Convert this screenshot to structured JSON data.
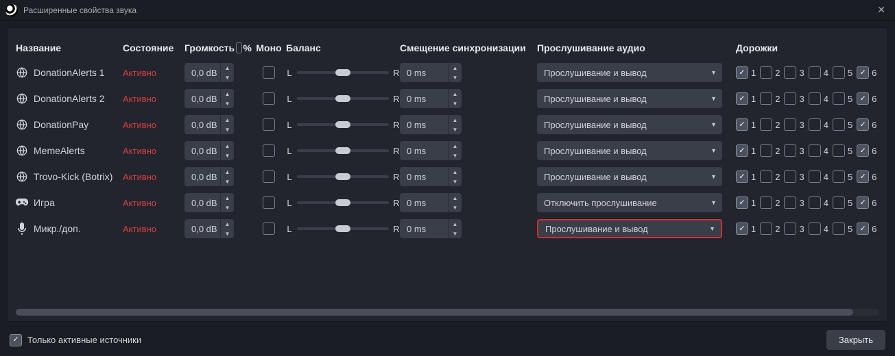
{
  "window": {
    "title": "Расширенные свойства звука"
  },
  "headers": {
    "name": "Название",
    "state": "Состояние",
    "volume": "Громкость",
    "pct": "%",
    "mono": "Моно",
    "balance": "Баланс",
    "sync": "Смещение синхронизации",
    "listen": "Прослушивание аудио",
    "tracks": "Дорожки"
  },
  "balance": {
    "left": "L",
    "right": "R"
  },
  "tracks": [
    "1",
    "2",
    "3",
    "4",
    "5",
    "6"
  ],
  "rows": [
    {
      "icon": "globe",
      "name": "DonationAlerts 1",
      "state": "Активно",
      "vol": "0,0 dB",
      "mono": false,
      "sync": "0 ms",
      "listen": "Прослушивание и вывод",
      "hl": false,
      "checks": [
        true,
        false,
        false,
        false,
        false,
        true
      ]
    },
    {
      "icon": "globe",
      "name": "DonationAlerts 2",
      "state": "Активно",
      "vol": "0,0 dB",
      "mono": false,
      "sync": "0 ms",
      "listen": "Прослушивание и вывод",
      "hl": false,
      "checks": [
        true,
        false,
        false,
        false,
        false,
        true
      ]
    },
    {
      "icon": "globe",
      "name": "DonationPay",
      "state": "Активно",
      "vol": "0,0 dB",
      "mono": false,
      "sync": "0 ms",
      "listen": "Прослушивание и вывод",
      "hl": false,
      "checks": [
        true,
        false,
        false,
        false,
        false,
        true
      ]
    },
    {
      "icon": "globe",
      "name": "MemeAlerts",
      "state": "Активно",
      "vol": "0,0 dB",
      "mono": false,
      "sync": "0 ms",
      "listen": "Прослушивание и вывод",
      "hl": false,
      "checks": [
        true,
        false,
        false,
        false,
        false,
        true
      ]
    },
    {
      "icon": "globe",
      "name": "Trovo-Kick (Botrix)",
      "state": "Активно",
      "vol": "0,0 dB",
      "mono": false,
      "sync": "0 ms",
      "listen": "Прослушивание и вывод",
      "hl": false,
      "checks": [
        true,
        false,
        false,
        false,
        false,
        true
      ]
    },
    {
      "icon": "gamepad",
      "name": "Игра",
      "state": "Активно",
      "vol": "0,0 dB",
      "mono": false,
      "sync": "0 ms",
      "listen": "Отключить прослушивание",
      "hl": false,
      "checks": [
        true,
        false,
        false,
        false,
        false,
        true
      ]
    },
    {
      "icon": "mic",
      "name": "Микр./доп.",
      "state": "Активно",
      "vol": "0,0 dB",
      "mono": false,
      "sync": "0 ms",
      "listen": "Прослушивание и вывод",
      "hl": true,
      "checks": [
        true,
        false,
        false,
        false,
        false,
        true
      ]
    }
  ],
  "footer": {
    "activeOnly": "Только активные источники",
    "activeOnlyChecked": true,
    "close": "Закрыть"
  }
}
